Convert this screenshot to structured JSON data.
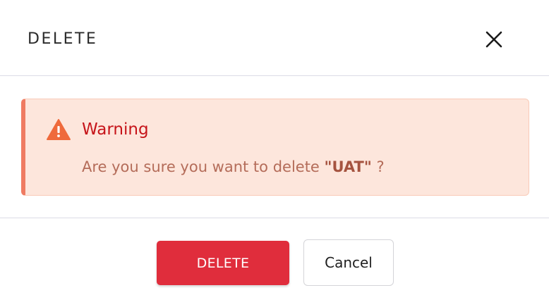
{
  "dialog": {
    "title": "DELETE",
    "close_icon": "close-icon"
  },
  "alert": {
    "icon": "warning-triangle-icon",
    "title": "Warning",
    "message_prefix": "Are you sure you want to delete ",
    "item_name": "\"UAT\"",
    "message_suffix": " ?",
    "colors": {
      "background": "#fde6dc",
      "accent": "#ef7b62",
      "title": "#c6141a",
      "text": "#b46c59"
    }
  },
  "footer": {
    "delete_label": "DELETE",
    "cancel_label": "Cancel",
    "colors": {
      "delete_bg": "#e02d3c"
    }
  }
}
